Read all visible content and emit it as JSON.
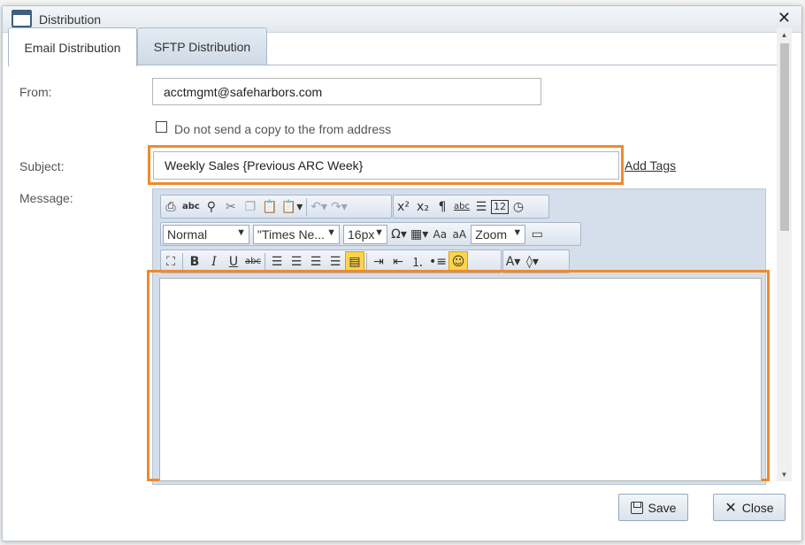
{
  "dialog": {
    "title": "Distribution",
    "close_glyph": "✕"
  },
  "tabs": [
    {
      "label": "Email Distribution",
      "active": true
    },
    {
      "label": "SFTP Distribution",
      "active": false
    }
  ],
  "form": {
    "from_label": "From:",
    "from_value": "acctmgmt@safeharbors.com",
    "copy_checkbox_label": "Do not send a copy to the from address",
    "copy_checkbox_checked": false,
    "subject_label": "Subject:",
    "subject_value": "Weekly Sales {Previous ARC Week}",
    "add_tags_label": "Add Tags",
    "message_label": "Message:"
  },
  "toolbar": {
    "row1": [
      "print-icon",
      "spellcheck-icon",
      "find-icon",
      "cut-icon",
      "copy-icon",
      "paste-icon",
      "paste-special-icon",
      "undo-icon",
      "redo-icon",
      "superscript-icon",
      "subscript-icon",
      "paragraph-icon",
      "format-icon",
      "align-icon",
      "date-icon",
      "time-icon"
    ],
    "format_select": "Normal",
    "font_select": "\"Times Ne...",
    "size_select": "16px",
    "zoom_select": "Zoom",
    "row2_icons": [
      "special-char-icon",
      "table-icon",
      "font-size-up-icon",
      "font-size-down-icon",
      "screen-icon"
    ],
    "row3": [
      "fullscreen-icon",
      "bold-icon",
      "italic-icon",
      "underline-icon",
      "strikethrough-icon",
      "align-left-icon",
      "align-center-icon",
      "align-right-icon",
      "justify-icon",
      "clear-format-icon",
      "indent-icon",
      "outdent-icon",
      "ordered-list-icon",
      "unordered-list-icon",
      "track-changes-icon",
      "font-color-icon",
      "highlight-icon"
    ]
  },
  "footer": {
    "save_label": "Save",
    "close_label": "Close"
  },
  "colors": {
    "highlight_outline": "#f08a2c",
    "active_toolbar_button": "#fcd34d"
  }
}
